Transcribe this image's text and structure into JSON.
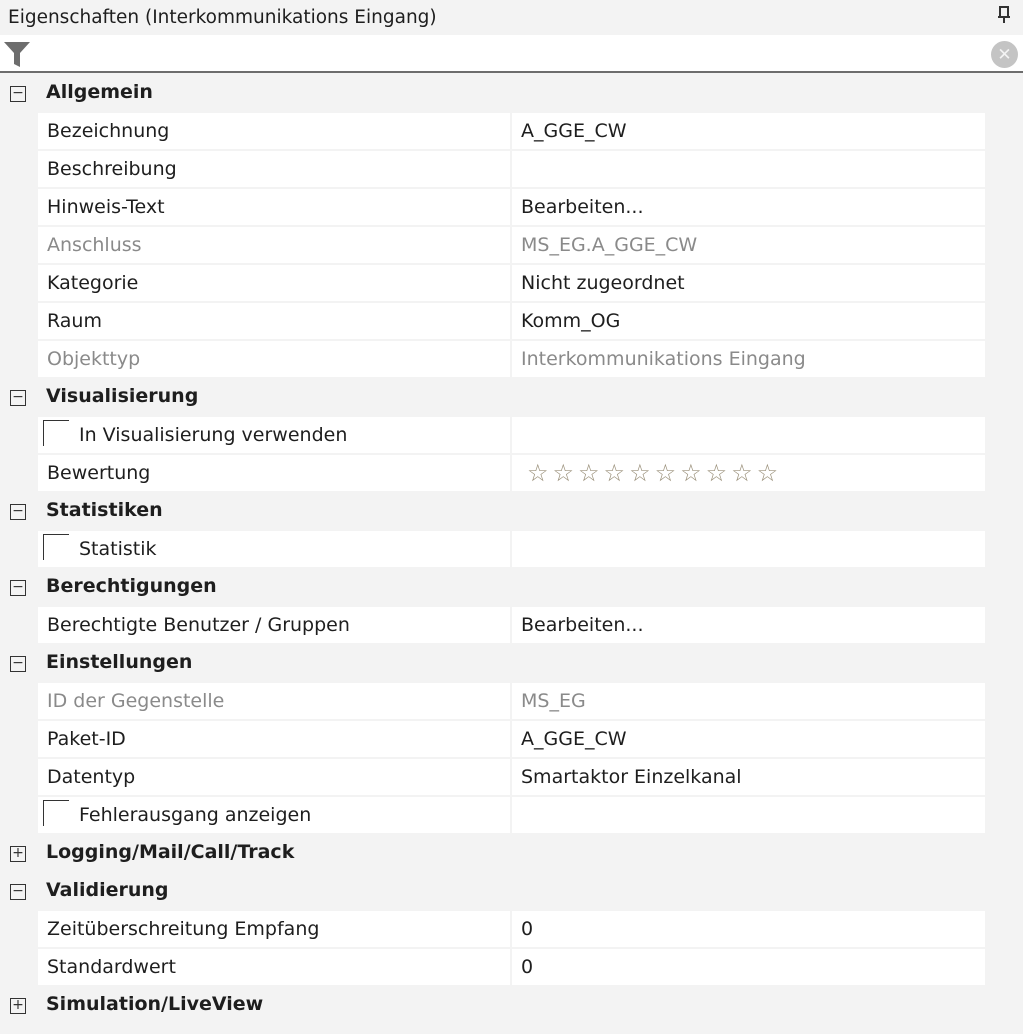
{
  "title": "Eigenschaften (Interkommunikations Eingang)",
  "filter": {
    "value": ""
  },
  "rows": [
    {
      "type": "cat",
      "label": "Allgemein",
      "expanded": true
    },
    {
      "type": "prop",
      "label": "Bezeichnung",
      "value": "A_GGE_CW"
    },
    {
      "type": "prop",
      "label": "Beschreibung",
      "value": ""
    },
    {
      "type": "prop",
      "label": "Hinweis-Text",
      "value": "Bearbeiten..."
    },
    {
      "type": "prop",
      "label": "Anschluss",
      "value": "MS_EG.A_GGE_CW",
      "disabled": true
    },
    {
      "type": "prop",
      "label": "Kategorie",
      "value": "Nicht zugeordnet"
    },
    {
      "type": "prop",
      "label": "Raum",
      "value": "Komm_OG"
    },
    {
      "type": "prop",
      "label": "Objekttyp",
      "value": "Interkommunikations Eingang",
      "disabled": true
    },
    {
      "type": "cat",
      "label": "Visualisierung",
      "expanded": true
    },
    {
      "type": "check",
      "label": "In Visualisierung verwenden",
      "checked": false
    },
    {
      "type": "rating",
      "label": "Bewertung",
      "rating": 0,
      "max": 10
    },
    {
      "type": "cat",
      "label": "Statistiken",
      "expanded": true
    },
    {
      "type": "check",
      "label": "Statistik",
      "checked": false
    },
    {
      "type": "cat",
      "label": "Berechtigungen",
      "expanded": true
    },
    {
      "type": "prop",
      "label": "Berechtigte Benutzer / Gruppen",
      "value": "Bearbeiten..."
    },
    {
      "type": "cat",
      "label": "Einstellungen",
      "expanded": true
    },
    {
      "type": "prop",
      "label": "ID der Gegenstelle",
      "value": "MS_EG",
      "disabled": true
    },
    {
      "type": "prop",
      "label": "Paket-ID",
      "value": "A_GGE_CW"
    },
    {
      "type": "prop",
      "label": "Datentyp",
      "value": "Smartaktor Einzelkanal"
    },
    {
      "type": "check",
      "label": "Fehlerausgang anzeigen",
      "checked": false
    },
    {
      "type": "cat",
      "label": "Logging/Mail/Call/Track",
      "expanded": false
    },
    {
      "type": "cat",
      "label": "Validierung",
      "expanded": true
    },
    {
      "type": "prop",
      "label": "Zeitüberschreitung Empfang",
      "value": "0"
    },
    {
      "type": "prop",
      "label": "Standardwert",
      "value": "0"
    },
    {
      "type": "cat",
      "label": "Simulation/LiveView",
      "expanded": false
    }
  ]
}
